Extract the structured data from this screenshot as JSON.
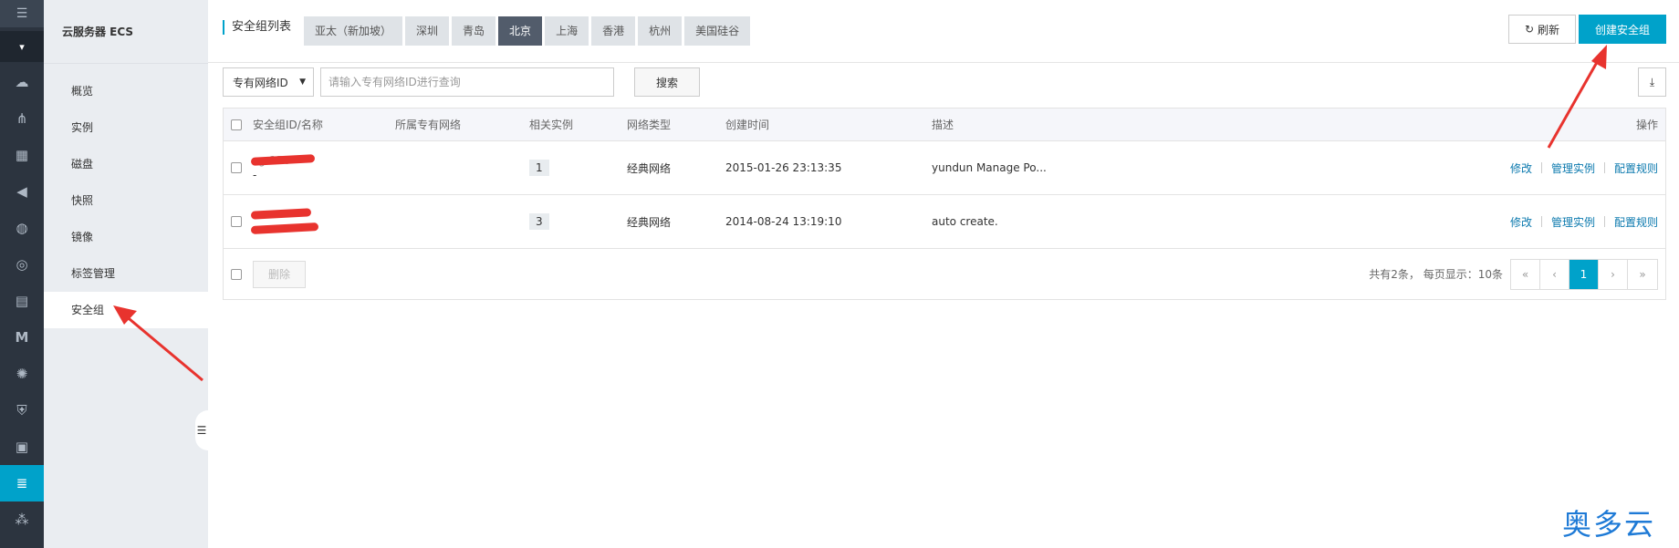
{
  "rail": {
    "menu_glyph": "☰",
    "caret_glyph": "▾",
    "icons": [
      {
        "name": "cloud-icon",
        "glyph": "☁"
      },
      {
        "name": "network-icon",
        "glyph": "⋔"
      },
      {
        "name": "dashboard-icon",
        "glyph": "▦"
      },
      {
        "name": "megaphone-icon",
        "glyph": "◀"
      },
      {
        "name": "globe-icon",
        "glyph": "◍"
      },
      {
        "name": "dns-icon",
        "glyph": "◎"
      },
      {
        "name": "storage-icon",
        "glyph": "▤"
      },
      {
        "name": "m-icon",
        "glyph": "M"
      },
      {
        "name": "gear-cloud-icon",
        "glyph": "✺"
      },
      {
        "name": "shield-icon",
        "glyph": "⛨"
      },
      {
        "name": "monitor-icon",
        "glyph": "▣"
      },
      {
        "name": "server-icon",
        "glyph": "≣"
      },
      {
        "name": "cluster-icon",
        "glyph": "⁂"
      }
    ]
  },
  "sidebar": {
    "title": "云服务器 ECS",
    "items": [
      {
        "label": "概览"
      },
      {
        "label": "实例"
      },
      {
        "label": "磁盘"
      },
      {
        "label": "快照"
      },
      {
        "label": "镜像"
      },
      {
        "label": "标签管理"
      },
      {
        "label": "安全组"
      }
    ],
    "collapse_glyph": "☰"
  },
  "header": {
    "title": "安全组列表",
    "regions": [
      "亚太（新加坡）",
      "深圳",
      "青岛",
      "北京",
      "上海",
      "香港",
      "杭州",
      "美国硅谷"
    ],
    "active_region": "北京",
    "refresh_label": "刷新",
    "refresh_icon": "↻",
    "create_label": "创建安全组"
  },
  "filter": {
    "select_value": "专有网络ID",
    "select_caret": "▼",
    "input_placeholder": "请输入专有网络ID进行查询",
    "search_label": "搜索",
    "export_glyph": "⤓"
  },
  "table": {
    "columns": [
      "安全组ID/名称",
      "所属专有网络",
      "相关实例",
      "网络类型",
      "创建时间",
      "描述",
      "操作"
    ],
    "rows": [
      {
        "id": "sg-256",
        "name": "-",
        "instances": "1",
        "network_type": "经典网络",
        "created": "2015-01-26 23:13:35",
        "description": "yundun Manage Po...",
        "actions": [
          "修改",
          "管理实例",
          "配置规则"
        ]
      },
      {
        "id": "",
        "name": "",
        "instances": "3",
        "network_type": "经典网络",
        "created": "2014-08-24 13:19:10",
        "description": "auto create.",
        "actions": [
          "修改",
          "管理实例",
          "配置规则"
        ]
      }
    ],
    "delete_label": "删除",
    "summary": "共有2条， 每页显示：10条",
    "pager": [
      "«",
      "‹",
      "1",
      "›",
      "»"
    ],
    "current_page": "1"
  },
  "watermark": "奥多云",
  "colors": {
    "accent": "#00a2ca",
    "rail_bg": "#2c343f",
    "link": "#0b79ae",
    "annotation": "#e8332e"
  }
}
